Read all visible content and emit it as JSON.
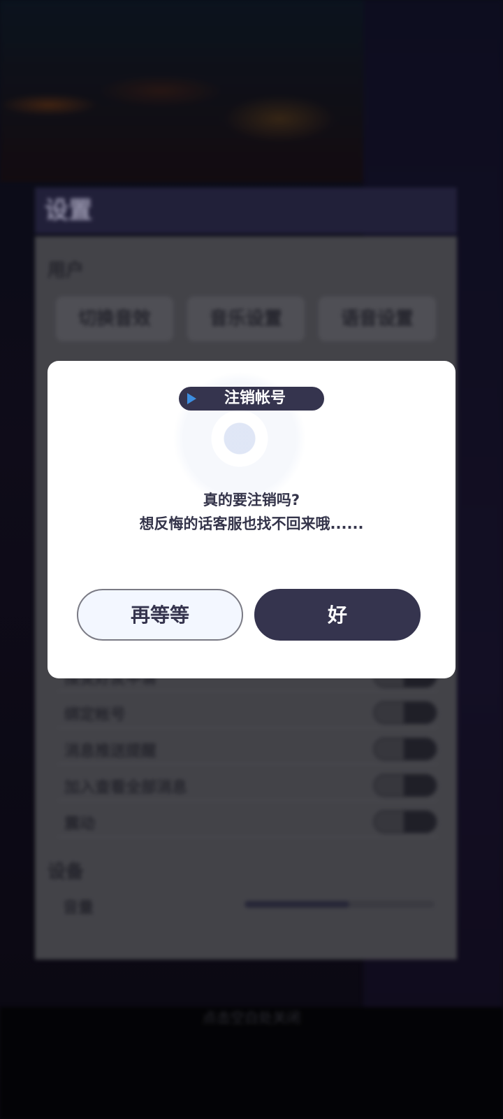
{
  "background": {
    "settings_title": "设置",
    "user_section_title": "用户",
    "tabs": [
      "切换音效",
      "音乐设置",
      "语音设置"
    ],
    "toggle_rows": [
      "接受好友申请",
      "绑定帐号",
      "消息推送提醒",
      "加入查看全部消息",
      "震动"
    ],
    "device_section_title": "设备",
    "slider_label": "音量",
    "slider_level": 0.55,
    "bottom_caption": "点击空白处关闭"
  },
  "dialog": {
    "title": "注销帐号",
    "message_line1": "真的要注销吗?",
    "message_line2": "想反悔的话客服也找不回来哦......",
    "cancel_label": "再等等",
    "confirm_label": "好"
  },
  "colors": {
    "dialog_dark": "#35344e",
    "dialog_light_button": "#f3f7ff",
    "title_arrow": "#3d8ee0"
  }
}
